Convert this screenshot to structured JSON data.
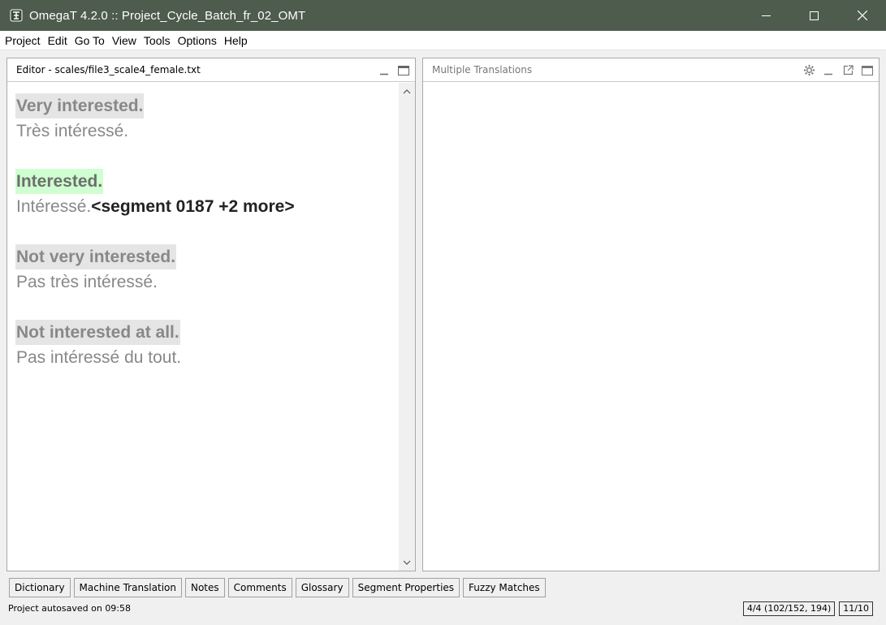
{
  "window": {
    "title": "OmegaT 4.2.0 :: Project_Cycle_Batch_fr_02_OMT"
  },
  "menu": [
    "Project",
    "Edit",
    "Go To",
    "View",
    "Tools",
    "Options",
    "Help"
  ],
  "editor": {
    "title": "Editor - scales/file3_scale4_female.txt",
    "segments": [
      {
        "source": "Very interested.",
        "target": "Très intéressé.",
        "active": false
      },
      {
        "source": "Interested.",
        "target": "Intéressé.",
        "tag": "<segment 0187 +2 more>",
        "active": true
      },
      {
        "source": "Not very interested.",
        "target": "Pas très intéressé.",
        "active": false
      },
      {
        "source": "Not interested at all.",
        "target": "Pas intéressé du tout.",
        "active": false
      }
    ]
  },
  "multiple_translations": {
    "title": "Multiple Translations"
  },
  "tabs": [
    "Dictionary",
    "Machine Translation",
    "Notes",
    "Comments",
    "Glossary",
    "Segment Properties",
    "Fuzzy Matches"
  ],
  "status": {
    "message": "Project autosaved on 09:58",
    "progress": "4/4 (102/152, 194)",
    "chars": "11/10"
  },
  "colors": {
    "titlebar": "#4d5c4d",
    "active_segment": "#cfffd0",
    "inactive_segment": "#e5e5e5"
  }
}
